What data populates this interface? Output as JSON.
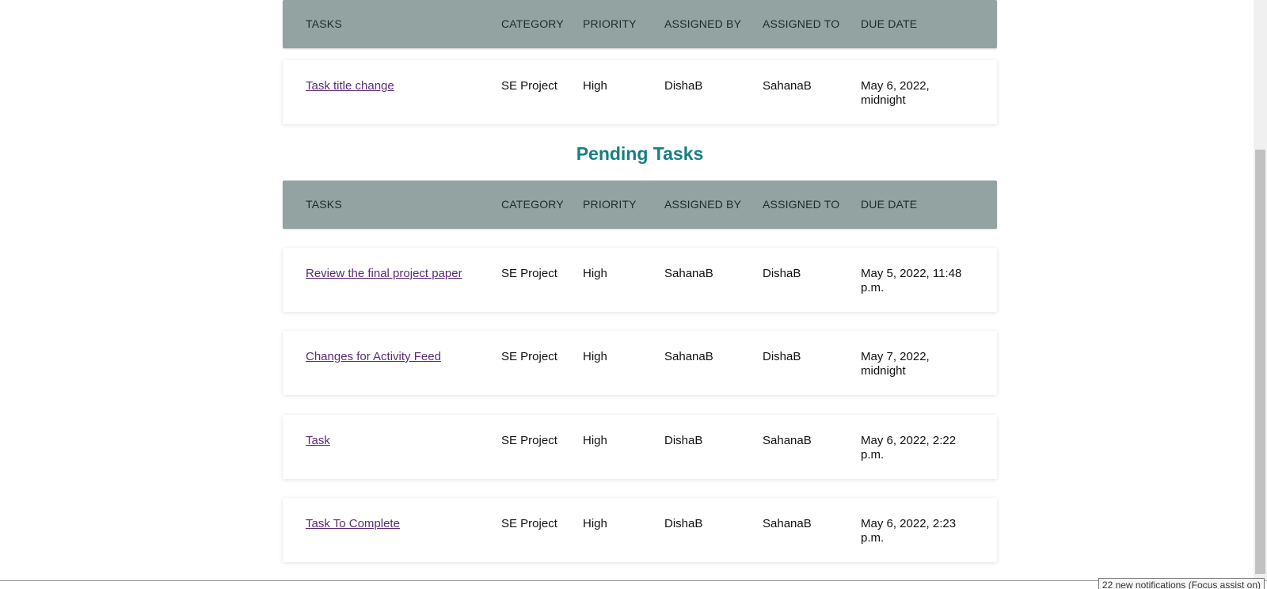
{
  "table_header": {
    "tasks": "TASKS",
    "category": "CATEGORY",
    "priority": "PRIORITY",
    "assigned_by": "ASSIGNED BY",
    "assigned_to": "ASSIGNED TO",
    "due_date": "DUE DATE"
  },
  "top_section": {
    "rows": [
      {
        "task": "Task title change",
        "category": "SE Project",
        "priority": "High",
        "assigned_by": "DishaB",
        "assigned_to": "SahanaB",
        "due_date": "May 6, 2022, midnight"
      }
    ]
  },
  "pending_section": {
    "title": "Pending Tasks",
    "rows": [
      {
        "task": "Review the final project paper",
        "category": "SE Project",
        "priority": "High",
        "assigned_by": "SahanaB",
        "assigned_to": "DishaB",
        "due_date": "May 5, 2022, 11:48 p.m."
      },
      {
        "task": "Changes for Activity Feed",
        "category": "SE Project",
        "priority": "High",
        "assigned_by": "SahanaB",
        "assigned_to": "DishaB",
        "due_date": "May 7, 2022, midnight"
      },
      {
        "task": "Task",
        "category": "SE Project",
        "priority": "High",
        "assigned_by": "DishaB",
        "assigned_to": "SahanaB",
        "due_date": "May 6, 2022, 2:22 p.m."
      },
      {
        "task": "Task To Complete",
        "category": "SE Project",
        "priority": "High",
        "assigned_by": "DishaB",
        "assigned_to": "SahanaB",
        "due_date": "May 6, 2022, 2:23 p.m."
      }
    ]
  },
  "notification_tooltip": "22 new notifications (Focus assist on)",
  "colors": {
    "header_bg": "#93a3a2",
    "section_title": "#167f7f",
    "link": "#5b2a76"
  }
}
